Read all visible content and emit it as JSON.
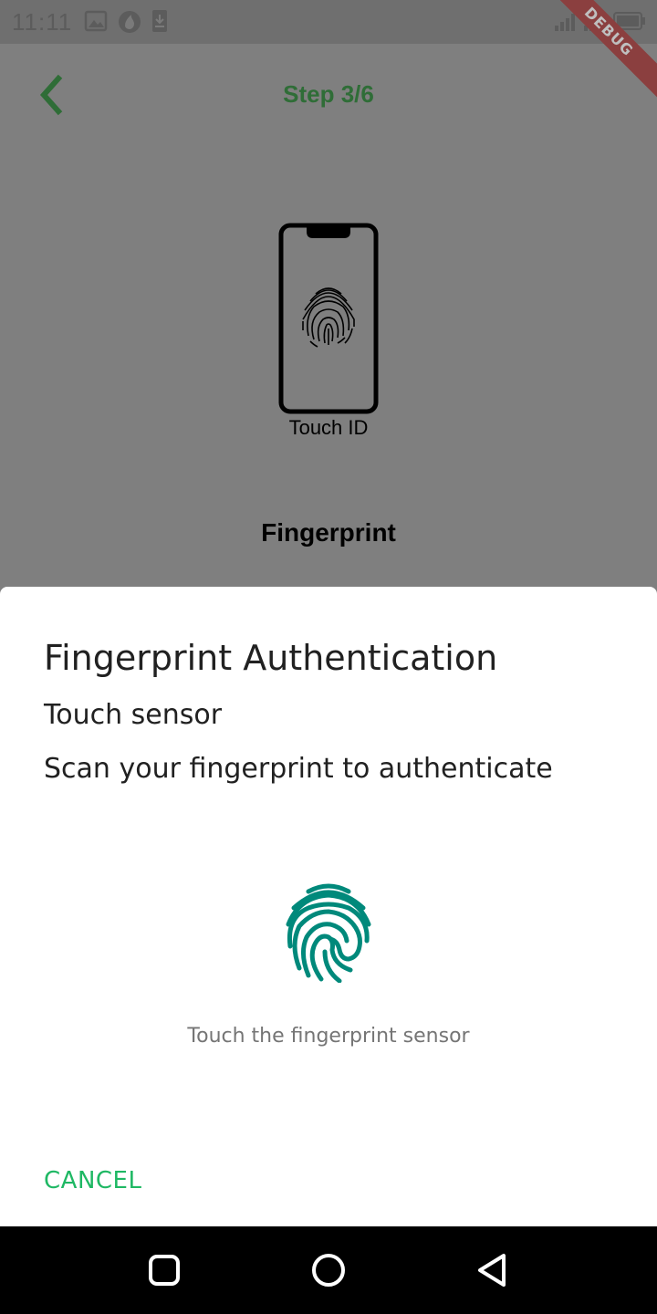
{
  "status_bar": {
    "time": "11:11",
    "left_icons": [
      "image-icon",
      "cloud-app-icon",
      "download-icon"
    ],
    "right_icons": [
      "signal-icon",
      "signal-icon",
      "battery-icon"
    ]
  },
  "debug_banner": {
    "label": "DEBUG",
    "color": "#8b3f3f"
  },
  "app_bar": {
    "back_icon": "chevron-left-icon",
    "title": "Step 3/6",
    "accent_color": "#2f6d37"
  },
  "illustration": {
    "icon": "phone-fingerprint-icon",
    "caption": "Touch ID"
  },
  "auth_method": {
    "label": "Fingerprint"
  },
  "dialog": {
    "title": "Fingerprint Authentication",
    "subtitle": "Touch sensor",
    "description": "Scan your fingerprint to authenticate",
    "fingerprint_icon": "fingerprint-icon",
    "fingerprint_color": "#00897b",
    "hint": "Touch the fingerprint sensor",
    "cancel_label": "CANCEL",
    "cancel_color": "#1fb864"
  },
  "nav_bar": {
    "buttons": [
      "recents-icon",
      "home-icon",
      "back-icon"
    ]
  }
}
